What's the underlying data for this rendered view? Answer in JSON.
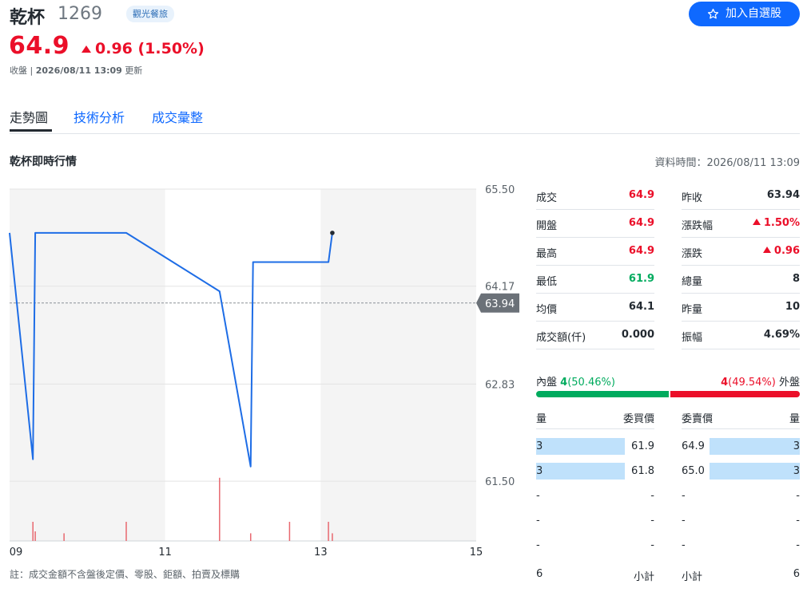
{
  "stock": {
    "name": "乾杯",
    "code": "1269",
    "industry": "觀光餐旅",
    "price": "64.9",
    "change": "0.96 (1.50%)",
    "status_prefix": "收盤 | ",
    "status_time": "2026/08/11 13:09",
    "status_suffix": " 更新",
    "add_watchlist": "加入自選股"
  },
  "tabs": [
    {
      "label": "走勢圖",
      "active": true
    },
    {
      "label": "技術分析",
      "active": false
    },
    {
      "label": "成交彙整",
      "active": false
    }
  ],
  "section": {
    "title": "乾杯即時行情",
    "data_time": "資料時間：2026/08/11 13:09"
  },
  "chart_data": {
    "type": "line",
    "y_ticks": [
      "65.50",
      "64.17",
      "62.83",
      "61.50"
    ],
    "ylim": [
      60.9,
      65.5
    ],
    "x_ticks": [
      "09",
      "11",
      "13",
      "15"
    ],
    "x_hour_range": [
      9,
      15
    ],
    "reference": {
      "label": "63.94",
      "value": 63.94
    },
    "line_color": "#1e6de6",
    "points": [
      {
        "t": 9.0,
        "v": 64.9
      },
      {
        "t": 9.3,
        "v": 61.8
      },
      {
        "t": 9.33,
        "v": 64.9
      },
      {
        "t": 10.5,
        "v": 64.9
      },
      {
        "t": 11.7,
        "v": 64.1
      },
      {
        "t": 12.1,
        "v": 61.7
      },
      {
        "t": 12.13,
        "v": 64.5
      },
      {
        "t": 13.1,
        "v": 64.5
      },
      {
        "t": 13.15,
        "v": 64.9
      }
    ],
    "volume": [
      {
        "t": 9.3,
        "v": 1
      },
      {
        "t": 9.33,
        "v": 0.5
      },
      {
        "t": 9.7,
        "v": 0.4
      },
      {
        "t": 10.5,
        "v": 1
      },
      {
        "t": 11.7,
        "v": 3.3
      },
      {
        "t": 12.1,
        "v": 0.4
      },
      {
        "t": 12.6,
        "v": 1
      },
      {
        "t": 13.1,
        "v": 1
      },
      {
        "t": 13.15,
        "v": 0.4
      }
    ],
    "shaded_sessions": [
      [
        9,
        11
      ],
      [
        13,
        15
      ]
    ]
  },
  "quote": {
    "left": [
      {
        "label": "成交",
        "value": "64.9",
        "tone": "up",
        "arrow": false
      },
      {
        "label": "開盤",
        "value": "64.9",
        "tone": "up",
        "arrow": false
      },
      {
        "label": "最高",
        "value": "64.9",
        "tone": "up",
        "arrow": false
      },
      {
        "label": "最低",
        "value": "61.9",
        "tone": "down",
        "arrow": false
      },
      {
        "label": "均價",
        "value": "64.1",
        "tone": "neutral",
        "arrow": false
      },
      {
        "label": "成交額(仟)",
        "value": "0.000",
        "tone": "neutral",
        "arrow": false
      }
    ],
    "right": [
      {
        "label": "昨收",
        "value": "63.94",
        "tone": "neutral",
        "arrow": false
      },
      {
        "label": "漲跌幅",
        "value": "1.50%",
        "tone": "up",
        "arrow": true
      },
      {
        "label": "漲跌",
        "value": "0.96",
        "tone": "up",
        "arrow": true
      },
      {
        "label": "總量",
        "value": "8",
        "tone": "neutral",
        "arrow": false
      },
      {
        "label": "昨量",
        "value": "10",
        "tone": "neutral",
        "arrow": false
      },
      {
        "label": "振幅",
        "value": "4.69%",
        "tone": "neutral",
        "arrow": false
      }
    ]
  },
  "inout": {
    "inner_label": "內盤",
    "inner_value": "4",
    "inner_pct": "(50.46%)",
    "inner_ratio": 0.5046,
    "outer_label": "外盤",
    "outer_value": "4",
    "outer_pct": "(49.54%)"
  },
  "orderbook": {
    "headers": {
      "bid_qty": "量",
      "bid_price": "委買價",
      "ask_price": "委賣價",
      "ask_qty": "量"
    },
    "rows": [
      {
        "bid_qty": "3",
        "bid_price": "61.9",
        "ask_price": "64.9",
        "ask_qty": "3",
        "bar": true
      },
      {
        "bid_qty": "3",
        "bid_price": "61.8",
        "ask_price": "65.0",
        "ask_qty": "3",
        "bar": true
      },
      {
        "bid_qty": "-",
        "bid_price": "-",
        "ask_price": "-",
        "ask_qty": "-",
        "bar": false
      },
      {
        "bid_qty": "-",
        "bid_price": "-",
        "ask_price": "-",
        "ask_qty": "-",
        "bar": false
      },
      {
        "bid_qty": "-",
        "bid_price": "-",
        "ask_price": "-",
        "ask_qty": "-",
        "bar": false
      }
    ],
    "subtotal": {
      "bid_qty": "6",
      "bid_label": "小計",
      "ask_label": "小計",
      "ask_qty": "6"
    }
  },
  "note": "註：成交金額不含盤後定價、零股、鉅額、拍賣及標購"
}
